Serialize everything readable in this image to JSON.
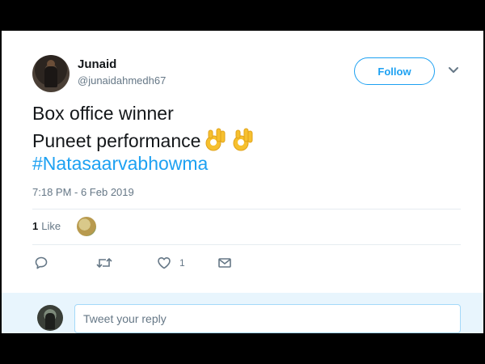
{
  "author": {
    "name": "Junaid",
    "handle": "@junaidahmedh67"
  },
  "follow_button": {
    "label": "Follow"
  },
  "tweet": {
    "lines": [
      "Box office winner",
      "Puneet performance"
    ],
    "emojis": [
      "ok-hand-emoji",
      "ok-hand-emoji"
    ],
    "hashtag": "#Natasaarvabhowma",
    "timestamp": "7:18 PM - 6 Feb 2019"
  },
  "engagement": {
    "like_count": "1",
    "like_label": "Like"
  },
  "actions": {
    "reply_icon": "reply-icon",
    "retweet_icon": "retweet-icon",
    "like_icon": "heart-icon",
    "like_count": "1",
    "message_icon": "envelope-icon"
  },
  "reply": {
    "placeholder": "Tweet your reply"
  },
  "colors": {
    "accent": "#1da1f2",
    "text": "#14171a",
    "muted": "#657786",
    "reply_bg": "#e8f5fd"
  }
}
